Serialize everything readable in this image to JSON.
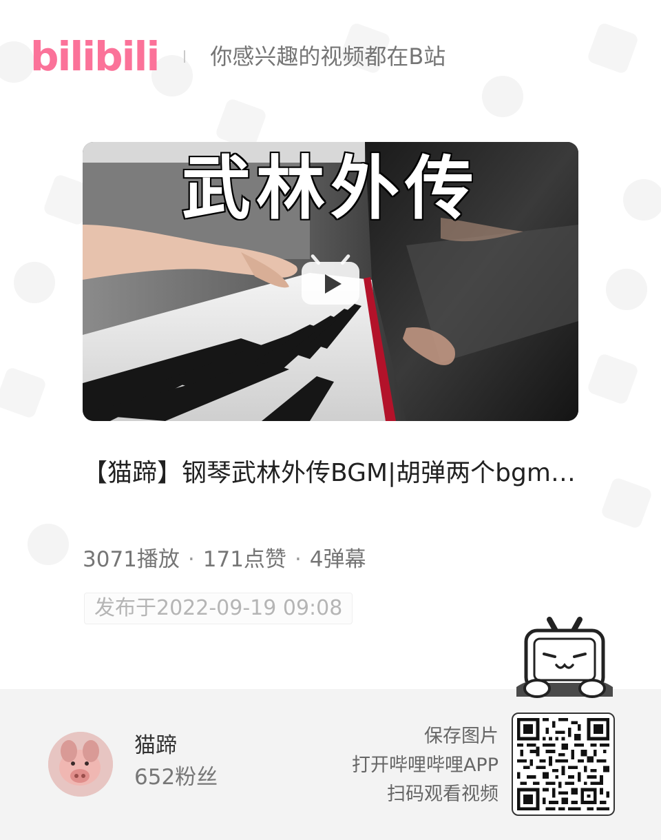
{
  "header": {
    "logo_text": "bilibili",
    "slogan": "你感兴趣的视频都在B站"
  },
  "video": {
    "cover_title": "武林外传",
    "title": "【猫蹄】钢琴武林外传BGM|胡弹两个bgm…",
    "stats": {
      "plays": "3071播放",
      "likes": "171点赞",
      "danmaku": "4弹幕",
      "separator": "·"
    },
    "publish_date": "发布于2022-09-19 09:08"
  },
  "author": {
    "name": "猫蹄",
    "fans": "652粉丝"
  },
  "qr_prompt": {
    "line1": "保存图片",
    "line2": "打开哔哩哔哩APP",
    "line3": "扫码观看视频"
  },
  "colors": {
    "brand_pink": "#fb7299",
    "footer_bg": "#f3f3f3",
    "title_text": "#212121",
    "meta_text": "#757575"
  },
  "icons": {
    "play": "play-icon",
    "mascot": "tv-mascot-icon",
    "qr": "qr-code"
  }
}
